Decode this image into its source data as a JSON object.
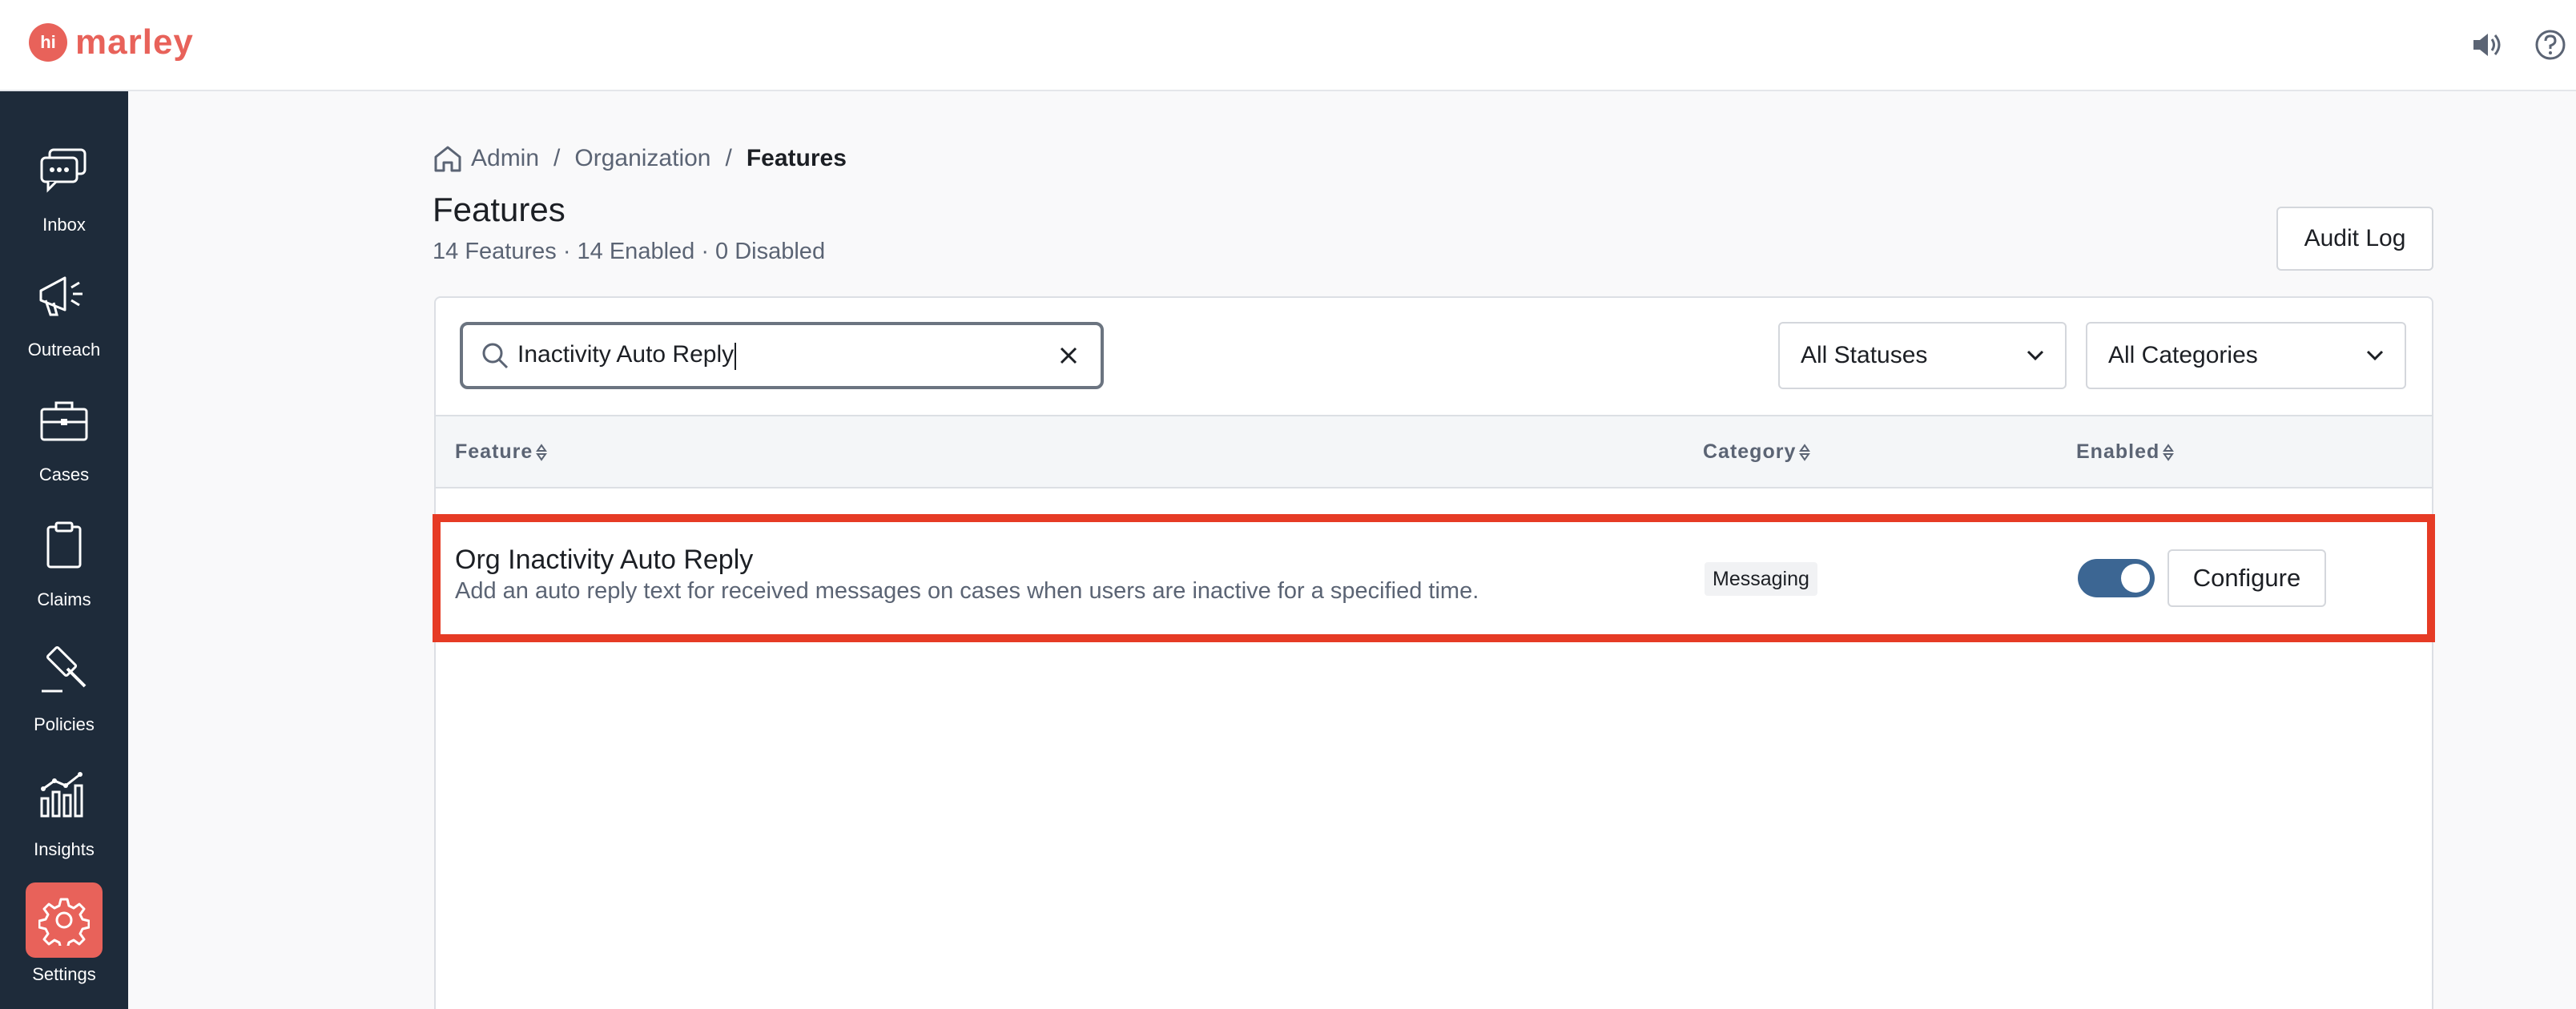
{
  "app": {
    "logo_badge": "hi",
    "logo_text": "marley",
    "brand_color": "#e8625a"
  },
  "topbar": {
    "icons": [
      "speaker-icon",
      "help-icon"
    ]
  },
  "sidebar": {
    "items": [
      {
        "label": "Inbox",
        "icon": "chat-bubble-icon"
      },
      {
        "label": "Outreach",
        "icon": "megaphone-icon"
      },
      {
        "label": "Cases",
        "icon": "briefcase-icon"
      },
      {
        "label": "Claims",
        "icon": "clipboard-icon"
      },
      {
        "label": "Policies",
        "icon": "gavel-icon"
      },
      {
        "label": "Insights",
        "icon": "bar-chart-icon"
      },
      {
        "label": "Settings",
        "icon": "gear-icon",
        "active": true
      }
    ]
  },
  "breadcrumb": {
    "items": [
      "Admin",
      "Organization"
    ],
    "current": "Features",
    "separator": "/"
  },
  "page": {
    "title": "Features",
    "subtitle": "14 Features · 14 Enabled · 0 Disabled",
    "audit_button": "Audit Log"
  },
  "filters": {
    "search_value": "Inactivity Auto Reply",
    "status_select": "All Statuses",
    "category_select": "All Categories"
  },
  "table": {
    "columns": [
      "Feature",
      "Category",
      "Enabled"
    ],
    "rows": [
      {
        "name": "Org Inactivity Auto Reply",
        "description": "Add an auto reply text for received messages on cases when users are inactive for a specified time.",
        "category": "Messaging",
        "enabled": true,
        "action": "Configure"
      }
    ]
  },
  "colors": {
    "sidebar_bg": "#1e2b3a",
    "toggle_on": "#3c6693",
    "highlight": "#e63b25"
  }
}
